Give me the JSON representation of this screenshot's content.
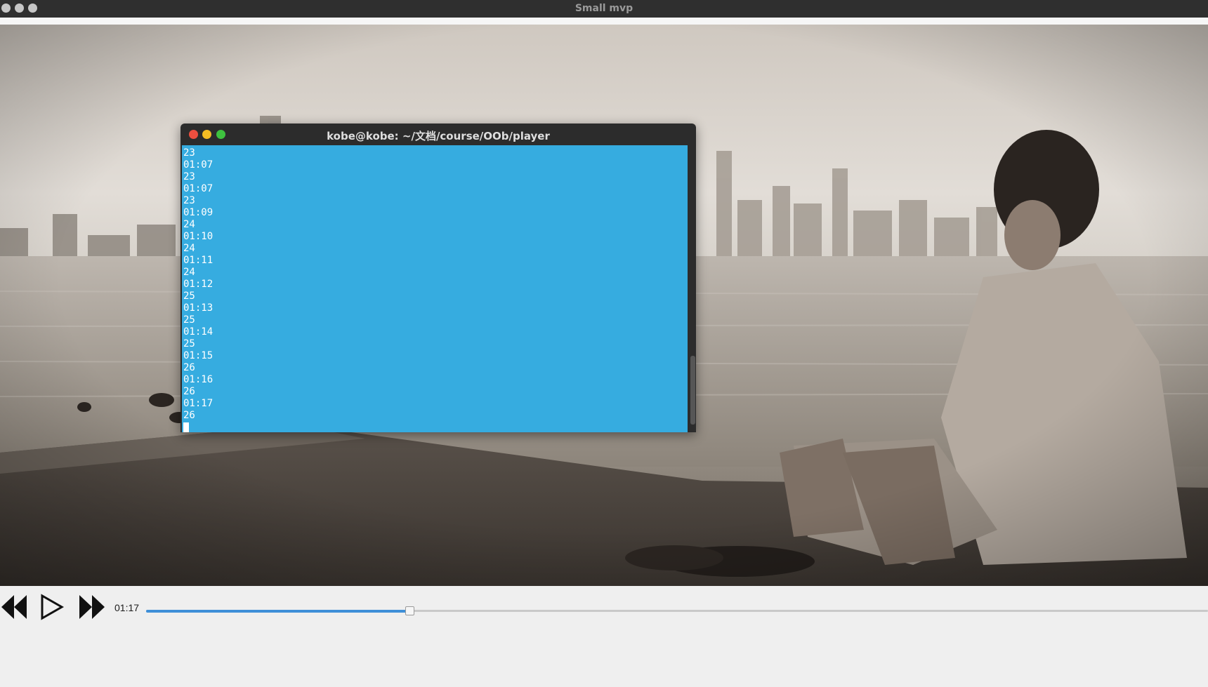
{
  "window": {
    "title": "Small mvp",
    "title_dots": [
      "close",
      "minimize",
      "maximize"
    ]
  },
  "terminal": {
    "title": "kobe@kobe: ~/文档/course/OOb/player",
    "buttons": [
      {
        "name": "close",
        "color": "#ed4f3f"
      },
      {
        "name": "minimize",
        "color": "#f4bd23"
      },
      {
        "name": "maximize",
        "color": "#3ec23f"
      }
    ],
    "lines": [
      "23",
      "01:07",
      "23",
      "01:07",
      "23",
      "01:09",
      "24",
      "01:10",
      "24",
      "01:11",
      "24",
      "01:12",
      "25",
      "01:13",
      "25",
      "01:14",
      "25",
      "01:15",
      "26",
      "01:16",
      "26",
      "01:17",
      "26"
    ],
    "background_color": "#36ace0"
  },
  "controls": {
    "rewind_icon": "rewind-icon",
    "play_icon": "play-icon",
    "forward_icon": "fast-forward-icon",
    "current_time": "01:17",
    "progress": 0.248,
    "accent_color": "#3e8fd8"
  }
}
